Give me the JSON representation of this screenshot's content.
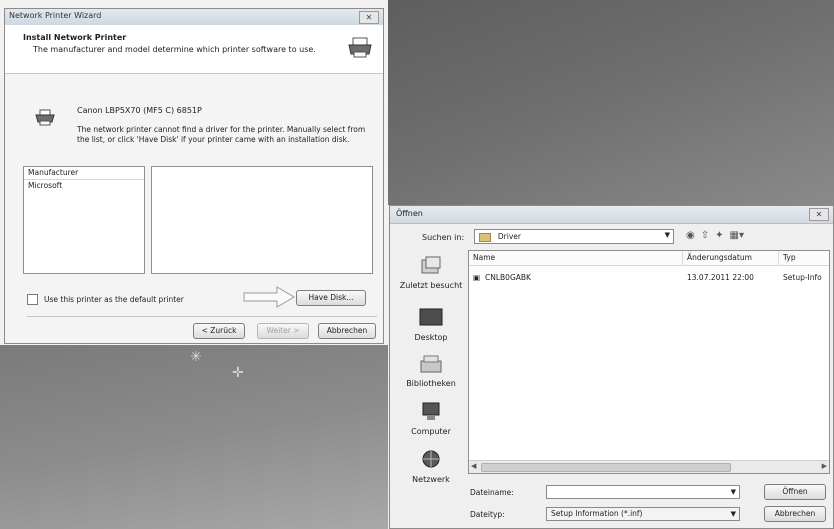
{
  "wizard": {
    "title": "Network Printer Wizard",
    "close": "✕",
    "heading": "Install Network Printer",
    "subheading": "The manufacturer and model determine which printer software to use.",
    "printer_name": "Canon LBP5X70 (MF5 C) 6851P",
    "info_text": "The network printer cannot find a driver for the printer. Manually select from the list, or click 'Have Disk' if your printer came with an installation disk.",
    "list_header": "Manufacturer",
    "list_items": [
      "Microsoft"
    ],
    "checkbox_label": "Use this printer as the default printer",
    "have_disk": "Have Disk...",
    "back": "< Zurück",
    "next": "Weiter >",
    "cancel": "Abbrechen"
  },
  "open_dialog": {
    "title": "Öffnen",
    "close": "✕",
    "look_in_label": "Suchen in:",
    "look_in_value": "Driver",
    "toolbar_icons": [
      "back-icon",
      "up-folder-icon",
      "new-folder-icon",
      "view-menu-icon"
    ],
    "places": [
      {
        "label": "Zuletzt besucht",
        "icon": "recent-places-icon"
      },
      {
        "label": "Desktop",
        "icon": "desktop-icon"
      },
      {
        "label": "Bibliotheken",
        "icon": "libraries-icon"
      },
      {
        "label": "Computer",
        "icon": "computer-icon"
      },
      {
        "label": "Netzwerk",
        "icon": "network-icon"
      }
    ],
    "columns": [
      "Name",
      "Änderungsdatum",
      "Typ"
    ],
    "files": [
      {
        "name": "CNLB0GABK",
        "date": "13.07.2011 22:00",
        "type": "Setup-Info"
      }
    ],
    "filename_label": "Dateiname:",
    "filename_value": "",
    "filetype_label": "Dateityp:",
    "filetype_value": "Setup Information (*.inf)",
    "open_button": "Öffnen",
    "cancel_button": "Abbrechen"
  }
}
